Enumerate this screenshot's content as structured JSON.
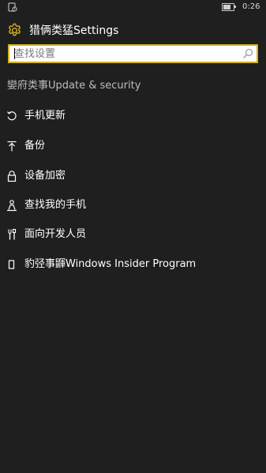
{
  "status_bar": {
    "time": "0:26",
    "battery_level": 0.75
  },
  "header": {
    "title": "猎俩类猛Settings",
    "icon": "gear-icon",
    "accent_color": "#d4b21e"
  },
  "search": {
    "placeholder": "查找设置"
  },
  "section": {
    "title": "孌府类事Update & security"
  },
  "menu_items": [
    {
      "label": "手机更新",
      "icon": "refresh-icon"
    },
    {
      "label": "备份",
      "icon": "upload-arrow-icon"
    },
    {
      "label": "设备加密",
      "icon": "lock-icon"
    },
    {
      "label": "查找我的手机",
      "icon": "person-pin-icon"
    },
    {
      "label": "面向开发人员",
      "icon": "developer-tools-icon"
    },
    {
      "label": "豹弪事鼲Windows Insider Program",
      "icon": "phone-icon"
    }
  ]
}
